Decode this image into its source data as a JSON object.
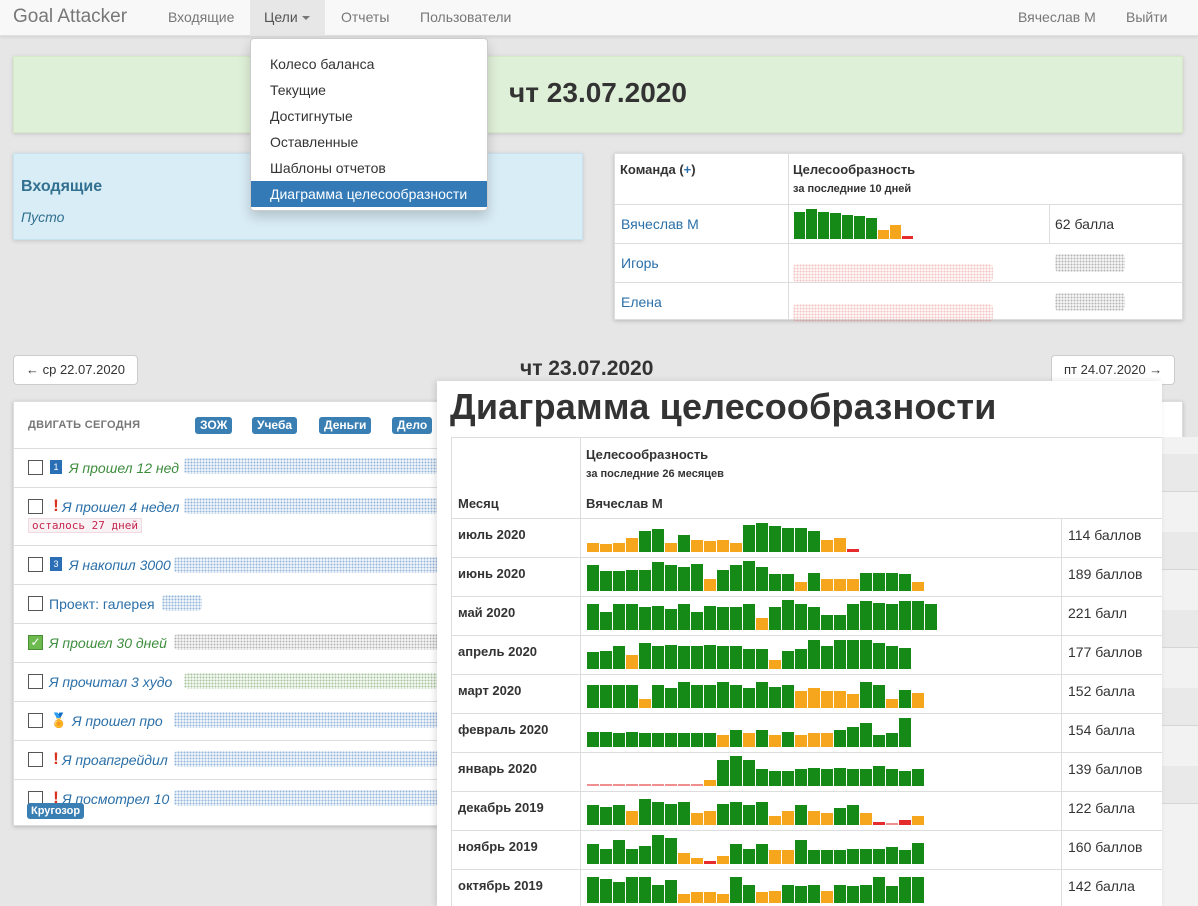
{
  "navbar": {
    "brand": "Goal Attacker",
    "items": [
      "Входящие",
      "Цели",
      "Отчеты",
      "Пользователи"
    ],
    "user": "Вячеслав М",
    "logout": "Выйти"
  },
  "dropdown": {
    "items": [
      "Колесо баланса",
      "Текущие",
      "Достигнутые",
      "Оставленные",
      "Шаблоны отчетов",
      "Диаграмма целесообразности"
    ],
    "active_index": 5
  },
  "banner": {
    "date": "чт 23.07.2020"
  },
  "inbox": {
    "title": "Входящие",
    "empty": "Пусто"
  },
  "team": {
    "header_team": "Команда",
    "add": "+",
    "header_fitness": "Целесообразность",
    "header_period": "за последние 10 дней",
    "members": [
      {
        "name": "Вячеслав М",
        "score": "62 балла"
      },
      {
        "name": "Игорь"
      },
      {
        "name": "Елена"
      }
    ]
  },
  "pager": {
    "prev": "← ср 22.07.2020",
    "title": "чт 23.07.2020",
    "next": "пт 24.07.2020 →"
  },
  "tasks": {
    "header": "ДВИГАТЬ СЕГОДНЯ",
    "tags": [
      "ЗОЖ",
      "Учеба",
      "Деньги",
      "Дело"
    ],
    "rows": [
      {
        "text": "Я прошел 12 нед",
        "icon": "1"
      },
      {
        "text": "Я прошел 4 недел",
        "icon": "!",
        "remaining": "осталось 27 дней"
      },
      {
        "text": "Я накопил 3000",
        "icon": "3"
      },
      {
        "text": "Проект: галерея"
      },
      {
        "text": "Я прошел 30 дней",
        "checked": true
      },
      {
        "text": "Я прочитал 3 худо"
      },
      {
        "text": "Я прошел про",
        "icon": "medal"
      },
      {
        "text": "Я проапгрейдил",
        "icon": "!"
      },
      {
        "text": "Я посмотрел 10",
        "icon": "!"
      }
    ],
    "bottom_tag": "Кругозор"
  },
  "popup": {
    "title": "Диаграмма целесообразности",
    "header_fitness": "Целесообразность",
    "header_period": "за последние 26 месяцев",
    "header_month": "Месяц",
    "header_user": "Вячеслав М",
    "rows": [
      {
        "month": "июль 2020",
        "score": "114 баллов"
      },
      {
        "month": "июнь 2020",
        "score": "189 баллов"
      },
      {
        "month": "май 2020",
        "score": "221 балл"
      },
      {
        "month": "апрель 2020",
        "score": "177 баллов"
      },
      {
        "month": "март 2020",
        "score": "152 балла"
      },
      {
        "month": "февраль 2020",
        "score": "154 балла"
      },
      {
        "month": "январь 2020",
        "score": "139 баллов"
      },
      {
        "month": "декабрь 2019",
        "score": "122 балла"
      },
      {
        "month": "ноябрь 2019",
        "score": "160 баллов"
      },
      {
        "month": "октябрь 2019",
        "score": "142 балла"
      }
    ]
  },
  "sparklines": {
    "colors": {
      "g": "#168a16",
      "o": "#f5a61d",
      "r": "#e52b2b",
      "p": "#f08f8f"
    },
    "team_vyacheslav": [
      [
        0.9,
        "g"
      ],
      [
        1,
        "g"
      ],
      [
        0.9,
        "g"
      ],
      [
        0.85,
        "g"
      ],
      [
        0.8,
        "g"
      ],
      [
        0.75,
        "g"
      ],
      [
        0.7,
        "g"
      ],
      [
        0.3,
        "o"
      ],
      [
        0.45,
        "o"
      ],
      [
        0.1,
        "r"
      ]
    ],
    "months": [
      [
        [
          0.3,
          "o"
        ],
        [
          0.25,
          "o"
        ],
        [
          0.3,
          "o"
        ],
        [
          0.45,
          "o"
        ],
        [
          0.7,
          "g"
        ],
        [
          0.75,
          "g"
        ],
        [
          0.3,
          "o"
        ],
        [
          0.55,
          "g"
        ],
        [
          0.4,
          "o"
        ],
        [
          0.35,
          "o"
        ],
        [
          0.4,
          "o"
        ],
        [
          0.3,
          "o"
        ],
        [
          0.9,
          "g"
        ],
        [
          0.95,
          "g"
        ],
        [
          0.85,
          "g"
        ],
        [
          0.8,
          "g"
        ],
        [
          0.8,
          "g"
        ],
        [
          0.7,
          "g"
        ],
        [
          0.4,
          "o"
        ],
        [
          0.45,
          "o"
        ],
        [
          0.1,
          "r"
        ]
      ],
      [
        [
          0.85,
          "g"
        ],
        [
          0.65,
          "g"
        ],
        [
          0.65,
          "g"
        ],
        [
          0.7,
          "g"
        ],
        [
          0.7,
          "g"
        ],
        [
          0.95,
          "g"
        ],
        [
          0.85,
          "g"
        ],
        [
          0.8,
          "g"
        ],
        [
          0.9,
          "g"
        ],
        [
          0.4,
          "o"
        ],
        [
          0.7,
          "g"
        ],
        [
          0.85,
          "g"
        ],
        [
          1,
          "g"
        ],
        [
          0.8,
          "g"
        ],
        [
          0.55,
          "g"
        ],
        [
          0.55,
          "g"
        ],
        [
          0.3,
          "o"
        ],
        [
          0.6,
          "g"
        ],
        [
          0.4,
          "o"
        ],
        [
          0.4,
          "o"
        ],
        [
          0.4,
          "o"
        ],
        [
          0.6,
          "g"
        ],
        [
          0.6,
          "g"
        ],
        [
          0.6,
          "g"
        ],
        [
          0.55,
          "g"
        ],
        [
          0.3,
          "o"
        ]
      ],
      [
        [
          0.85,
          "g"
        ],
        [
          0.6,
          "g"
        ],
        [
          0.85,
          "g"
        ],
        [
          0.85,
          "g"
        ],
        [
          0.75,
          "g"
        ],
        [
          0.8,
          "g"
        ],
        [
          0.7,
          "g"
        ],
        [
          0.85,
          "g"
        ],
        [
          0.6,
          "g"
        ],
        [
          0.8,
          "g"
        ],
        [
          0.75,
          "g"
        ],
        [
          0.75,
          "g"
        ],
        [
          0.85,
          "g"
        ],
        [
          0.4,
          "o"
        ],
        [
          0.75,
          "g"
        ],
        [
          1,
          "g"
        ],
        [
          0.85,
          "g"
        ],
        [
          0.75,
          "g"
        ],
        [
          0.5,
          "g"
        ],
        [
          0.5,
          "g"
        ],
        [
          0.85,
          "g"
        ],
        [
          0.95,
          "g"
        ],
        [
          0.9,
          "g"
        ],
        [
          0.85,
          "g"
        ],
        [
          0.95,
          "g"
        ],
        [
          0.95,
          "g"
        ],
        [
          0.85,
          "g"
        ]
      ],
      [
        [
          0.55,
          "g"
        ],
        [
          0.6,
          "g"
        ],
        [
          0.75,
          "g"
        ],
        [
          0.45,
          "o"
        ],
        [
          0.85,
          "g"
        ],
        [
          0.75,
          "g"
        ],
        [
          0.8,
          "g"
        ],
        [
          0.75,
          "g"
        ],
        [
          0.75,
          "g"
        ],
        [
          0.8,
          "g"
        ],
        [
          0.75,
          "g"
        ],
        [
          0.75,
          "g"
        ],
        [
          0.65,
          "g"
        ],
        [
          0.65,
          "g"
        ],
        [
          0.3,
          "o"
        ],
        [
          0.6,
          "g"
        ],
        [
          0.65,
          "g"
        ],
        [
          0.95,
          "g"
        ],
        [
          0.75,
          "g"
        ],
        [
          0.95,
          "g"
        ],
        [
          0.95,
          "g"
        ],
        [
          0.95,
          "g"
        ],
        [
          0.85,
          "g"
        ],
        [
          0.75,
          "g"
        ],
        [
          0.7,
          "g"
        ]
      ],
      [
        [
          0.75,
          "g"
        ],
        [
          0.75,
          "g"
        ],
        [
          0.75,
          "g"
        ],
        [
          0.75,
          "g"
        ],
        [
          0.3,
          "o"
        ],
        [
          0.75,
          "g"
        ],
        [
          0.65,
          "g"
        ],
        [
          0.85,
          "g"
        ],
        [
          0.75,
          "g"
        ],
        [
          0.75,
          "g"
        ],
        [
          0.85,
          "g"
        ],
        [
          0.75,
          "g"
        ],
        [
          0.65,
          "g"
        ],
        [
          0.85,
          "g"
        ],
        [
          0.7,
          "g"
        ],
        [
          0.75,
          "g"
        ],
        [
          0.55,
          "o"
        ],
        [
          0.65,
          "o"
        ],
        [
          0.55,
          "o"
        ],
        [
          0.55,
          "o"
        ],
        [
          0.45,
          "o"
        ],
        [
          0.85,
          "g"
        ],
        [
          0.75,
          "g"
        ],
        [
          0.3,
          "o"
        ],
        [
          0.6,
          "g"
        ],
        [
          0.5,
          "o"
        ]
      ],
      [
        [
          0.5,
          "g"
        ],
        [
          0.5,
          "g"
        ],
        [
          0.45,
          "g"
        ],
        [
          0.5,
          "g"
        ],
        [
          0.45,
          "g"
        ],
        [
          0.45,
          "g"
        ],
        [
          0.45,
          "g"
        ],
        [
          0.45,
          "g"
        ],
        [
          0.45,
          "g"
        ],
        [
          0.45,
          "g"
        ],
        [
          0.4,
          "o"
        ],
        [
          0.55,
          "g"
        ],
        [
          0.45,
          "o"
        ],
        [
          0.55,
          "g"
        ],
        [
          0.4,
          "o"
        ],
        [
          0.5,
          "g"
        ],
        [
          0.4,
          "o"
        ],
        [
          0.45,
          "o"
        ],
        [
          0.45,
          "o"
        ],
        [
          0.55,
          "g"
        ],
        [
          0.65,
          "g"
        ],
        [
          0.8,
          "g"
        ],
        [
          0.4,
          "g"
        ],
        [
          0.45,
          "g"
        ],
        [
          0.95,
          "g"
        ]
      ],
      [
        [
          0.05,
          "p"
        ],
        [
          0.05,
          "p"
        ],
        [
          0.05,
          "p"
        ],
        [
          0.05,
          "p"
        ],
        [
          0.05,
          "p"
        ],
        [
          0.05,
          "p"
        ],
        [
          0.05,
          "p"
        ],
        [
          0.05,
          "p"
        ],
        [
          0.05,
          "p"
        ],
        [
          0.2,
          "o"
        ],
        [
          0.85,
          "g"
        ],
        [
          1,
          "g"
        ],
        [
          0.85,
          "g"
        ],
        [
          0.55,
          "g"
        ],
        [
          0.5,
          "g"
        ],
        [
          0.5,
          "g"
        ],
        [
          0.55,
          "g"
        ],
        [
          0.6,
          "g"
        ],
        [
          0.55,
          "g"
        ],
        [
          0.6,
          "g"
        ],
        [
          0.55,
          "g"
        ],
        [
          0.55,
          "g"
        ],
        [
          0.65,
          "g"
        ],
        [
          0.55,
          "g"
        ],
        [
          0.5,
          "g"
        ],
        [
          0.55,
          "g"
        ]
      ],
      [
        [
          0.65,
          "g"
        ],
        [
          0.6,
          "g"
        ],
        [
          0.65,
          "g"
        ],
        [
          0.45,
          "o"
        ],
        [
          0.85,
          "g"
        ],
        [
          0.75,
          "g"
        ],
        [
          0.7,
          "g"
        ],
        [
          0.75,
          "g"
        ],
        [
          0.4,
          "o"
        ],
        [
          0.45,
          "o"
        ],
        [
          0.7,
          "g"
        ],
        [
          0.75,
          "g"
        ],
        [
          0.65,
          "g"
        ],
        [
          0.75,
          "g"
        ],
        [
          0.3,
          "o"
        ],
        [
          0.45,
          "o"
        ],
        [
          0.65,
          "g"
        ],
        [
          0.45,
          "o"
        ],
        [
          0.4,
          "o"
        ],
        [
          0.55,
          "g"
        ],
        [
          0.65,
          "g"
        ],
        [
          0.4,
          "o"
        ],
        [
          0.1,
          "r"
        ],
        [
          0.05,
          "p"
        ],
        [
          0.15,
          "r"
        ],
        [
          0.3,
          "o"
        ]
      ],
      [
        [
          0.65,
          "g"
        ],
        [
          0.5,
          "g"
        ],
        [
          0.8,
          "g"
        ],
        [
          0.5,
          "g"
        ],
        [
          0.6,
          "g"
        ],
        [
          0.95,
          "g"
        ],
        [
          0.85,
          "g"
        ],
        [
          0.35,
          "o"
        ],
        [
          0.2,
          "o"
        ],
        [
          0.1,
          "r"
        ],
        [
          0.25,
          "o"
        ],
        [
          0.65,
          "g"
        ],
        [
          0.5,
          "g"
        ],
        [
          0.65,
          "g"
        ],
        [
          0.45,
          "o"
        ],
        [
          0.45,
          "o"
        ],
        [
          0.8,
          "g"
        ],
        [
          0.45,
          "g"
        ],
        [
          0.45,
          "g"
        ],
        [
          0.45,
          "g"
        ],
        [
          0.5,
          "g"
        ],
        [
          0.5,
          "g"
        ],
        [
          0.5,
          "g"
        ],
        [
          0.55,
          "g"
        ],
        [
          0.45,
          "g"
        ],
        [
          0.7,
          "g"
        ]
      ],
      [
        [
          0.85,
          "g"
        ],
        [
          0.8,
          "g"
        ],
        [
          0.7,
          "g"
        ],
        [
          0.85,
          "g"
        ],
        [
          0.85,
          "g"
        ],
        [
          0.6,
          "g"
        ],
        [
          0.75,
          "g"
        ],
        [
          0.3,
          "o"
        ],
        [
          0.35,
          "o"
        ],
        [
          0.35,
          "o"
        ],
        [
          0.3,
          "o"
        ],
        [
          0.85,
          "g"
        ],
        [
          0.6,
          "g"
        ],
        [
          0.35,
          "o"
        ],
        [
          0.4,
          "o"
        ],
        [
          0.6,
          "g"
        ],
        [
          0.55,
          "g"
        ],
        [
          0.6,
          "g"
        ],
        [
          0.4,
          "o"
        ],
        [
          0.6,
          "g"
        ],
        [
          0.55,
          "g"
        ],
        [
          0.6,
          "g"
        ],
        [
          0.85,
          "g"
        ],
        [
          0.55,
          "g"
        ],
        [
          0.85,
          "g"
        ],
        [
          0.85,
          "g"
        ]
      ]
    ]
  }
}
